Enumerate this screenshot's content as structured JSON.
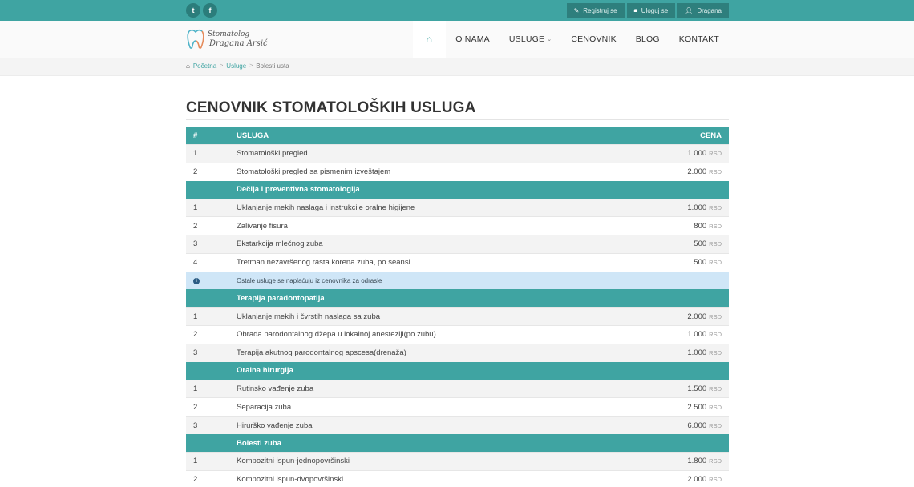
{
  "topbar": {
    "social": [
      {
        "icon": "twitter-icon",
        "glyph": "t"
      },
      {
        "icon": "facebook-icon",
        "glyph": "f"
      }
    ],
    "actions": [
      {
        "icon": "pencil-icon",
        "label": "Registruj se"
      },
      {
        "icon": "lock-icon",
        "label": "Uloguj se"
      },
      {
        "icon": "user-icon",
        "label": "Dragana"
      }
    ]
  },
  "logo": {
    "line1": "Stomatolog",
    "line2": "Dragana Arsić"
  },
  "nav": {
    "items": [
      "O NAMA",
      "USLUGE",
      "CENOVNIK",
      "BLOG",
      "KONTAKT"
    ]
  },
  "breadcrumb": {
    "items": [
      "Početna",
      "Usluge",
      "Bolesti usta"
    ]
  },
  "page": {
    "title": "CENOVNIK STOMATOLOŠKIH USLUGA"
  },
  "table": {
    "headers": {
      "num": "#",
      "service": "USLUGA",
      "price": "CENA"
    },
    "currency": "RSD",
    "rows": [
      {
        "type": "item",
        "num": "1",
        "service": "Stomatološki pregled",
        "price": "1.000"
      },
      {
        "type": "item",
        "num": "2",
        "service": "Stomatološki pregled sa pismenim izveštajem",
        "price": "2.000"
      },
      {
        "type": "category",
        "service": "Dečija i preventivna stomatologija"
      },
      {
        "type": "item",
        "num": "1",
        "service": "Uklanjanje mekih naslaga i instrukcije oralne higijene",
        "price": "1.000"
      },
      {
        "type": "item",
        "num": "2",
        "service": "Zalivanje fisura",
        "price": "800"
      },
      {
        "type": "item",
        "num": "3",
        "service": "Ekstarkcija mlečnog zuba",
        "price": "500"
      },
      {
        "type": "item",
        "num": "4",
        "service": "Tretman nezavršenog rasta korena zuba, po seansi",
        "price": "500"
      },
      {
        "type": "info",
        "service": "Ostale usluge se naplaćuju iz cenovnika za odrasle"
      },
      {
        "type": "category",
        "service": "Terapija paradontopatija"
      },
      {
        "type": "item",
        "num": "1",
        "service": "Uklanjanje mekih i čvrstih naslaga sa zuba",
        "price": "2.000"
      },
      {
        "type": "item",
        "num": "2",
        "service": "Obrada parodontalnog džepa u lokalnoj anesteziji(po zubu)",
        "price": "1.000"
      },
      {
        "type": "item",
        "num": "3",
        "service": "Terapija akutnog parodontalnog apscesa(drenaža)",
        "price": "1.000"
      },
      {
        "type": "category",
        "service": "Oralna hirurgija"
      },
      {
        "type": "item",
        "num": "1",
        "service": "Rutinsko vađenje zuba",
        "price": "1.500"
      },
      {
        "type": "item",
        "num": "2",
        "service": "Separacija zuba",
        "price": "2.500"
      },
      {
        "type": "item",
        "num": "3",
        "service": "Hirurško vađenje zuba",
        "price": "6.000"
      },
      {
        "type": "category",
        "service": "Bolesti zuba"
      },
      {
        "type": "item",
        "num": "1",
        "service": "Kompozitni ispun-jednopovršinski",
        "price": "1.800"
      },
      {
        "type": "item",
        "num": "2",
        "service": "Kompozitni ispun-dvopovršinski",
        "price": "2.000"
      }
    ]
  },
  "colors": {
    "primary": "#3fa4a2",
    "info_bg": "#cfe6f7"
  }
}
